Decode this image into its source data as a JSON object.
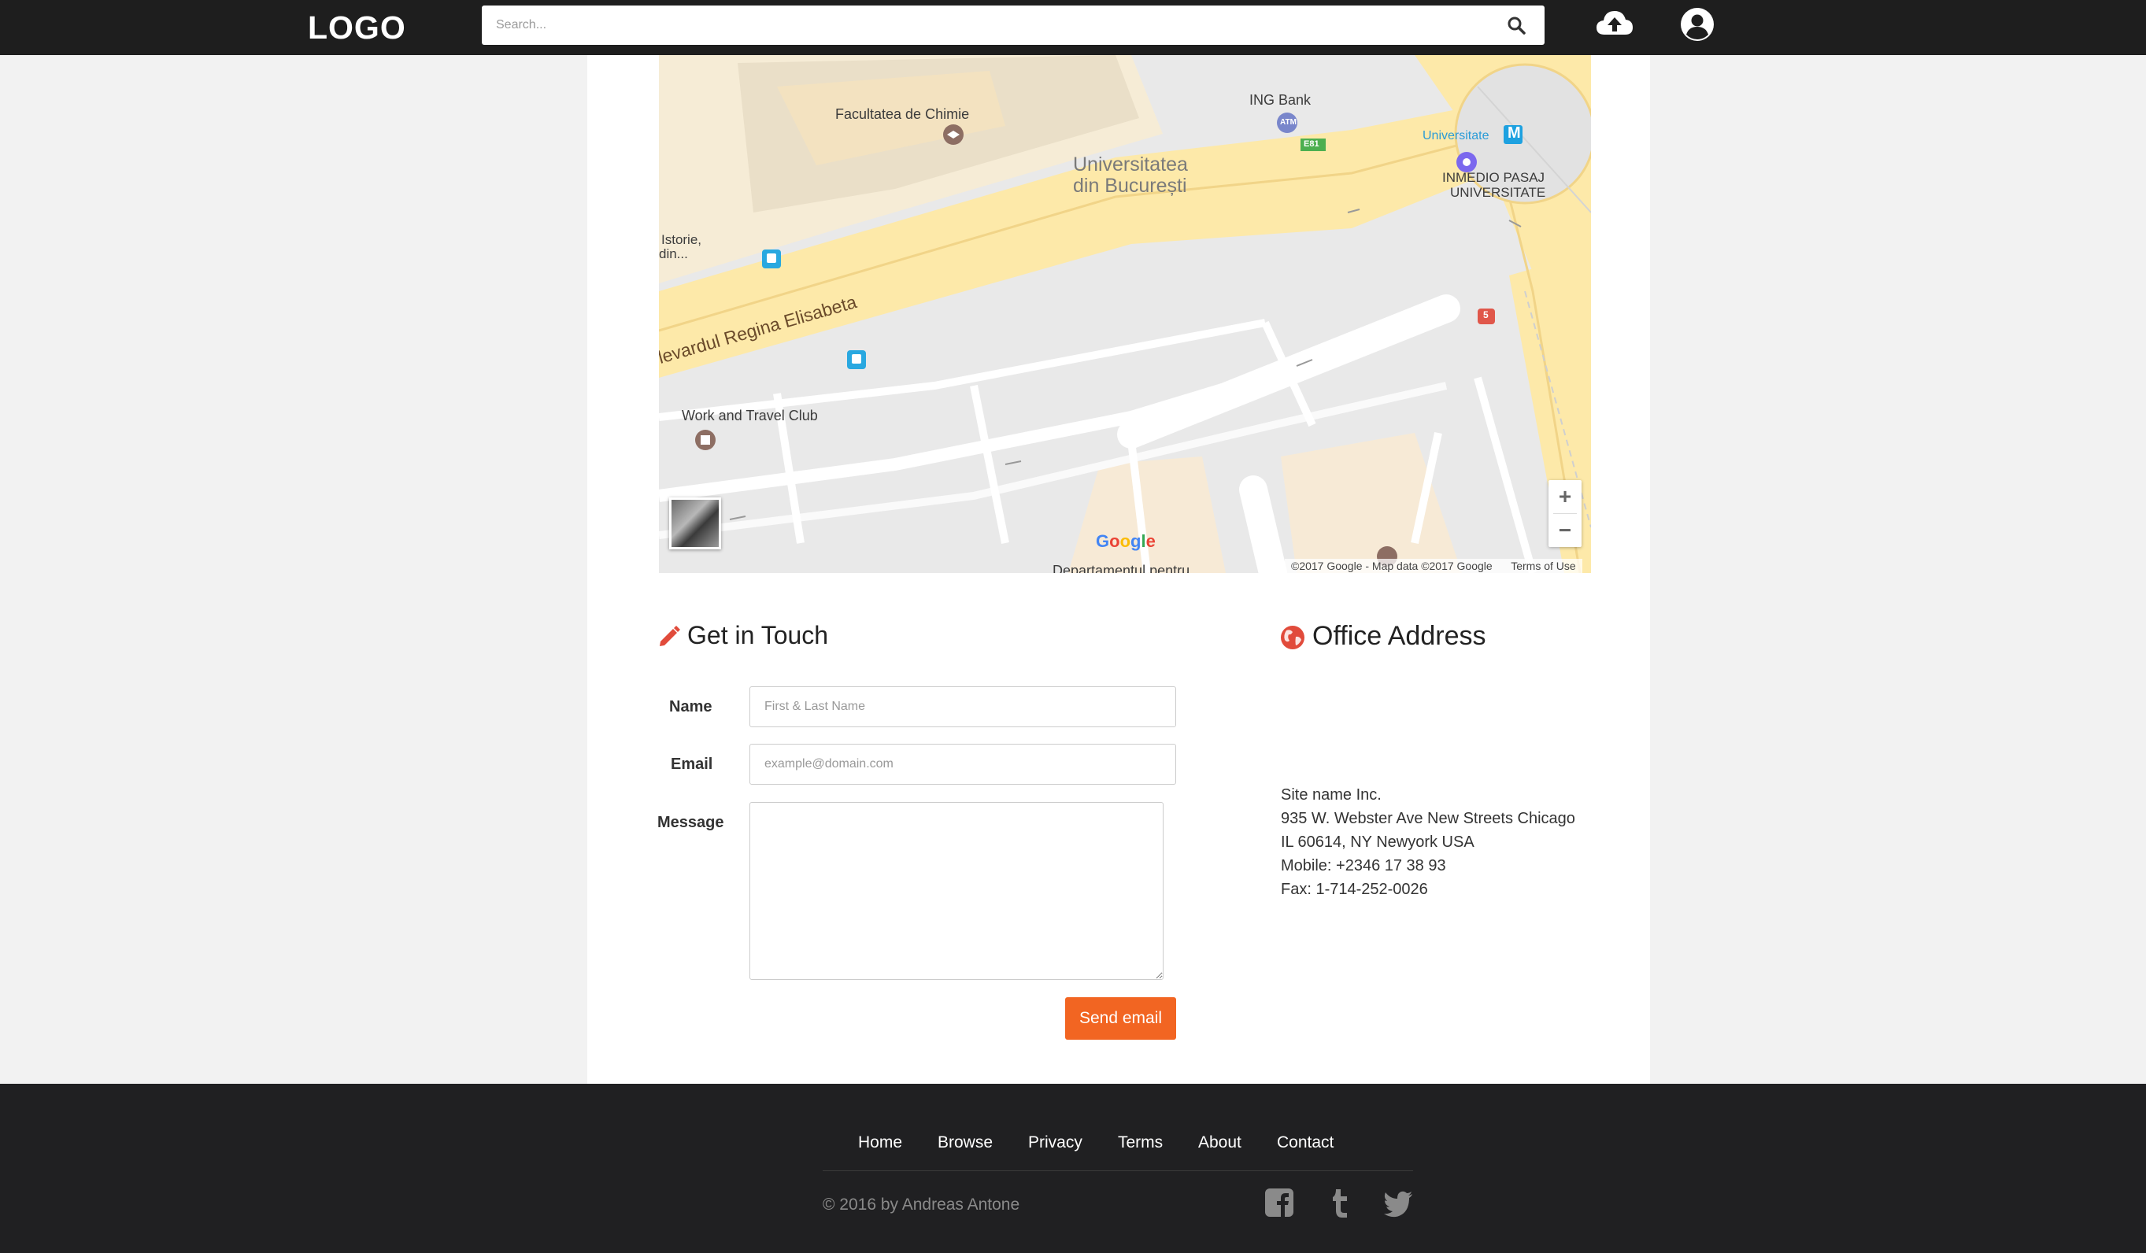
{
  "header": {
    "logo": "LOGO",
    "search_placeholder": "Search..."
  },
  "map": {
    "labels": {
      "faculty": "Facultatea de Chimie",
      "ing": "ING Bank",
      "univ1": "Universitatea",
      "univ2": "din București",
      "universitate": "Universitate",
      "inmedio1": "INMEDIO PASAJ",
      "inmedio2": "UNIVERSITATE",
      "istorie1": "Istorie,",
      "istorie2": "din...",
      "boulevard": "levardul Regina Elisabeta",
      "work_travel": "Work and Travel Club",
      "departament": "Departamentul pentru",
      "e81": "E81",
      "atm": "ATM",
      "route5": "5"
    },
    "zoom_in": "+",
    "zoom_out": "−",
    "google": "Google",
    "attribution": "©2017 Google - Map data ©2017 Google",
    "terms": "Terms of Use"
  },
  "contact": {
    "title": "Get in Touch",
    "name_label": "Name",
    "name_placeholder": "First & Last Name",
    "email_label": "Email",
    "email_placeholder": "example@domain.com",
    "message_label": "Message",
    "send_label": "Send email"
  },
  "office": {
    "title": "Office Address",
    "lines": [
      "Site name Inc.",
      "935 W. Webster Ave New Streets Chicago",
      "IL 60614, NY Newyork USA",
      "Mobile: +2346 17 38 93",
      "Fax: 1-714-252-0026"
    ]
  },
  "footer": {
    "links": [
      "Home",
      "Browse",
      "Privacy",
      "Terms",
      "About",
      "Contact"
    ],
    "copyright": "© 2016 by Andreas Antone",
    "social_icons": [
      "facebook-icon",
      "tumblr-icon",
      "twitter-icon"
    ]
  },
  "colors": {
    "accent": "#f26522",
    "header_bg": "#1e1e1e",
    "footer_bg": "#202022",
    "road_yellow": "#fde9a9"
  }
}
